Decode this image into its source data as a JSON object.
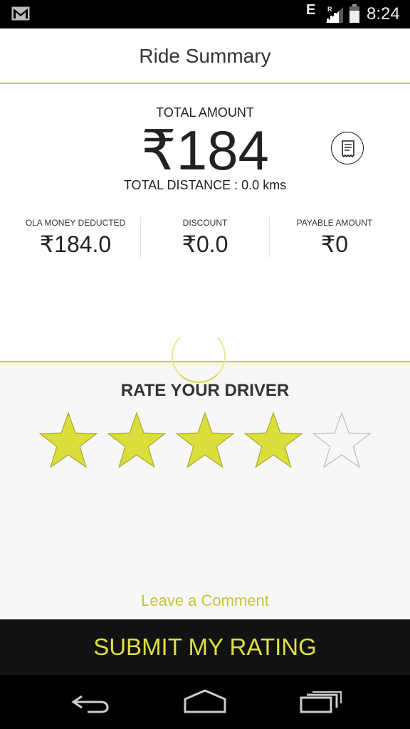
{
  "status_bar": {
    "network_type": "E",
    "roaming": "R",
    "time": "8:24",
    "icons": [
      "gmail-icon",
      "signal-icon",
      "battery-icon"
    ]
  },
  "header": {
    "title": "Ride Summary"
  },
  "summary": {
    "total_label": "TOTAL AMOUNT",
    "total_amount": "₹184",
    "total_distance": "TOTAL DISTANCE : 0.0 kms",
    "receipt_icon": "receipt-icon",
    "stats": [
      {
        "label": "OLA MONEY DEDUCTED",
        "value": "₹184.0"
      },
      {
        "label": "DISCOUNT",
        "value": "₹0.0"
      },
      {
        "label": "PAYABLE AMOUNT",
        "value": "₹0"
      }
    ]
  },
  "rating": {
    "title": "RATE YOUR DRIVER",
    "rating_value": 4,
    "max_rating": 5,
    "leave_comment": "Leave a Comment"
  },
  "submit": {
    "label": "SUBMIT MY RATING"
  },
  "colors": {
    "accent": "#cccc33",
    "star_filled": "#d9de3a",
    "comment_link": "#c8c43a",
    "submit_text": "#dede45",
    "submit_bg": "#121212"
  },
  "nav_bar": {
    "icons": [
      "back-icon",
      "home-icon",
      "recent-apps-icon"
    ]
  }
}
